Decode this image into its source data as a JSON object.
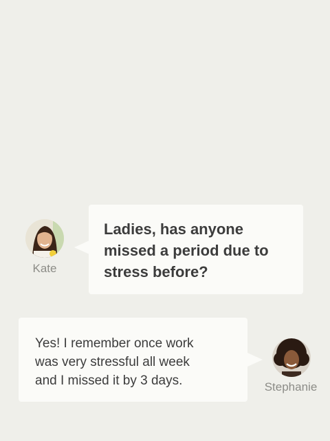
{
  "messages": [
    {
      "sender": "Kate",
      "text": "Ladies, has anyone\nmissed a period due to\nstress before?"
    },
    {
      "sender": "Stephanie",
      "text": "Yes! I remember once work\nwas very stressful all week\nand I missed it by 3 days."
    }
  ],
  "colors": {
    "background": "#efefea",
    "bubble": "#fbfbf8",
    "text": "#3c3c3c",
    "name": "#8c8c87"
  }
}
